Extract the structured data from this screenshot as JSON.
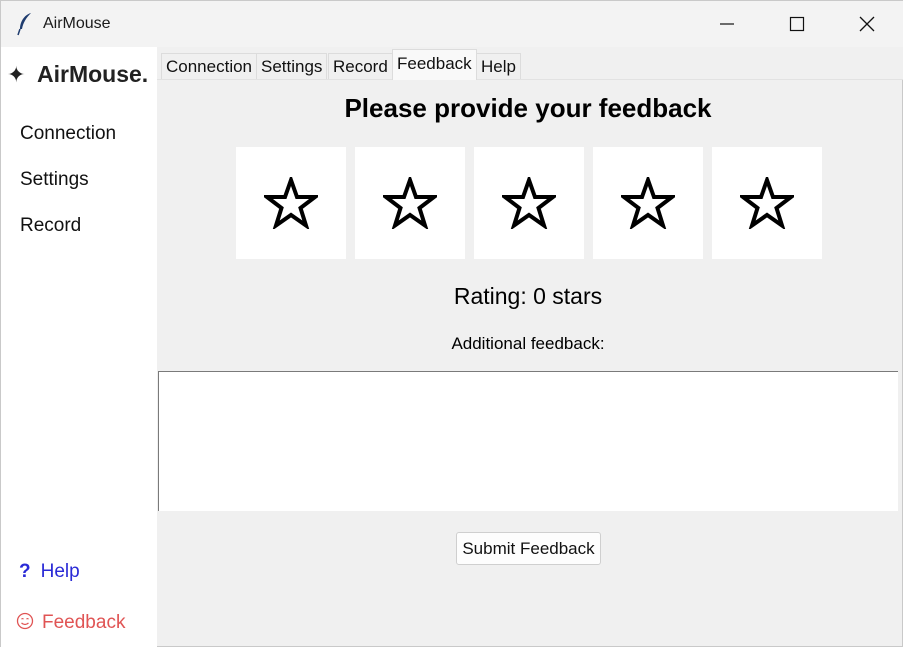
{
  "window": {
    "title": "AirMouse",
    "icon": "feather-icon",
    "controls": [
      "minimize-icon",
      "maximize-icon",
      "close-icon"
    ]
  },
  "sidebar": {
    "brand_icon": "✦",
    "brand": "AirMouse.",
    "items": [
      {
        "label": "Connection"
      },
      {
        "label": "Settings"
      },
      {
        "label": "Record"
      }
    ],
    "help": {
      "icon": "?",
      "label": "Help",
      "color": "#2a2ad6"
    },
    "feedback": {
      "icon": "smile-icon",
      "label": "Feedback",
      "color": "#e05454"
    }
  },
  "tabs": [
    {
      "label": "Connection"
    },
    {
      "label": "Settings"
    },
    {
      "label": "Record"
    },
    {
      "label": "Feedback",
      "active": true
    },
    {
      "label": "Help"
    }
  ],
  "feedback_page": {
    "heading": "Please provide your feedback",
    "stars": {
      "count": 5,
      "selected": 0,
      "icon": "star-outline-icon"
    },
    "rating_text": "Rating: 0 stars",
    "additional_label": "Additional feedback:",
    "textarea_value": "",
    "submit_label": "Submit Feedback"
  }
}
